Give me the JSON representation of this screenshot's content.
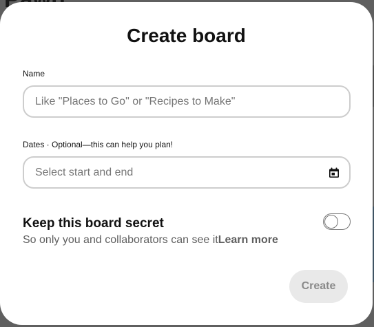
{
  "background": {
    "page_title_fragment": "Pawn"
  },
  "modal": {
    "title": "Create board",
    "name_field": {
      "label": "Name",
      "value": "",
      "placeholder": "Like \"Places to Go\" or \"Recipes to Make\""
    },
    "dates_field": {
      "label": "Dates · Optional—this can help you plan!",
      "placeholder": "Select start and end",
      "icon": "calendar-icon"
    },
    "secret": {
      "title": "Keep this board secret",
      "description": "So only you and collaborators can see it",
      "link": "Learn more",
      "toggle_on": false
    },
    "create_button": {
      "label": "Create",
      "enabled": false
    }
  }
}
